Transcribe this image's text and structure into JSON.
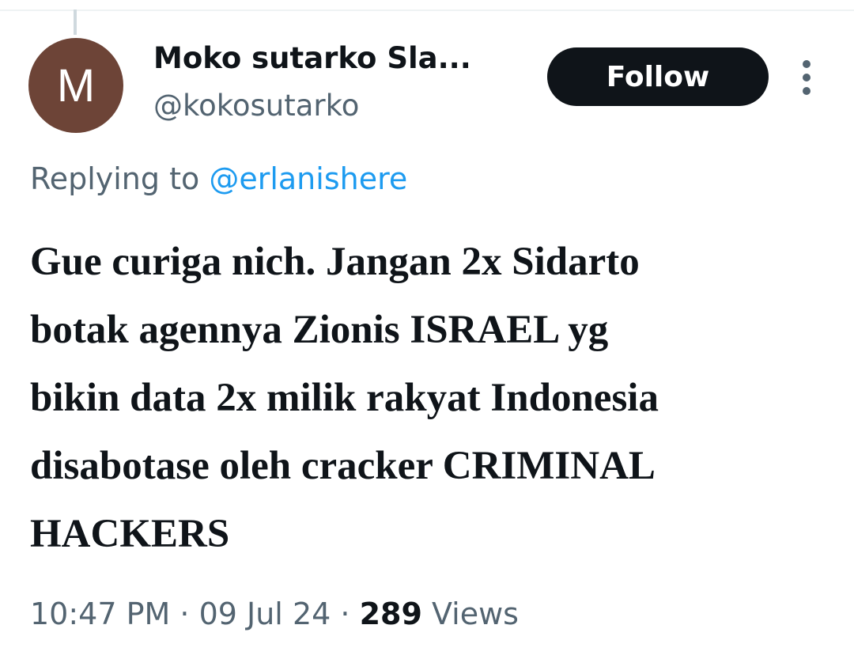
{
  "tweet": {
    "avatar_initial": "M",
    "display_name": "Moko sutarko Sla...",
    "handle": "@kokosutarko",
    "follow_label": "Follow",
    "reply_prefix": "Replying to",
    "reply_to": "@erlanishere",
    "text": "Gue curiga nich. Jangan 2x Sidarto\nbotak agennya Zionis ISRAEL yg\nbikin data 2x milik rakyat Indonesia\ndisabotase oleh cracker CRIMINAL\nHACKERS",
    "time": "10:47 PM",
    "separator": "·",
    "date": "09 Jul 24",
    "views_count": "289",
    "views_label": "Views"
  },
  "icons": {
    "more": "more-vertical-icon"
  },
  "colors": {
    "avatar_bg": "#6d4437",
    "follow_bg": "#0f1419",
    "mention": "#1d9bf0",
    "secondary_text": "#536471",
    "primary_text": "#0f1419"
  }
}
